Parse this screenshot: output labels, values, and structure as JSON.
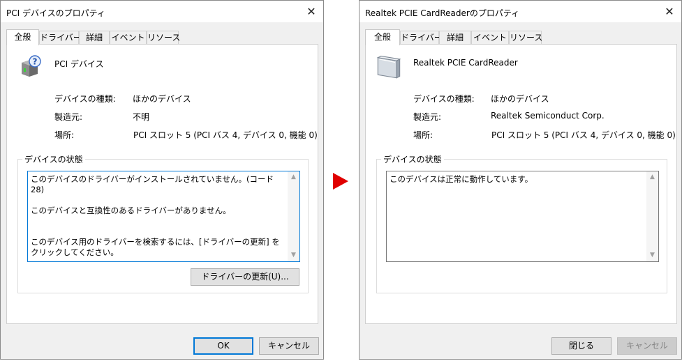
{
  "left_dialog": {
    "title": "PCI デバイスのプロパティ",
    "tabs": [
      {
        "label": "全般"
      },
      {
        "label": "ドライバー"
      },
      {
        "label": "詳細"
      },
      {
        "label": "イベント"
      },
      {
        "label": "リソース"
      }
    ],
    "device_name": "PCI デバイス",
    "device_icon": "unknown-device-question-icon",
    "properties": [
      {
        "label": "デバイスの種類:",
        "value": "ほかのデバイス"
      },
      {
        "label": "製造元:",
        "value": "不明"
      },
      {
        "label": "場所:",
        "value": "PCI スロット 5 (PCI バス 4, デバイス 0, 機能 0)"
      }
    ],
    "status_group_title": "デバイスの状態",
    "status_text": "このデバイスのドライバーがインストールされていません。(コード 28)\n\nこのデバイスと互換性のあるドライバーがありません。\n\n\nこのデバイス用のドライバーを検索するには、[ドライバーの更新] をクリックしてください。",
    "update_driver_button": "ドライバーの更新(U)...",
    "ok_button": "OK",
    "cancel_button": "キャンセル"
  },
  "right_dialog": {
    "title": "Realtek PCIE CardReaderのプロパティ",
    "tabs": [
      {
        "label": "全般"
      },
      {
        "label": "ドライバー"
      },
      {
        "label": "詳細"
      },
      {
        "label": "イベント"
      },
      {
        "label": "リソース"
      }
    ],
    "device_name": "Realtek PCIE CardReader",
    "device_icon": "card-reader-icon",
    "properties": [
      {
        "label": "デバイスの種類:",
        "value": "ほかのデバイス"
      },
      {
        "label": "製造元:",
        "value": "Realtek Semiconduct Corp."
      },
      {
        "label": "場所:",
        "value": "PCI スロット 5 (PCI バス 4, デバイス 0, 機能 0)"
      }
    ],
    "status_group_title": "デバイスの状態",
    "status_text": "このデバイスは正常に動作しています。",
    "close_button": "閉じる",
    "cancel_button": "キャンセル"
  },
  "colors": {
    "arrow": "#e00000",
    "focus_accent": "#0078d7"
  },
  "icons": {
    "close": "close-icon",
    "arrow": "right-triangle-arrow-icon"
  }
}
